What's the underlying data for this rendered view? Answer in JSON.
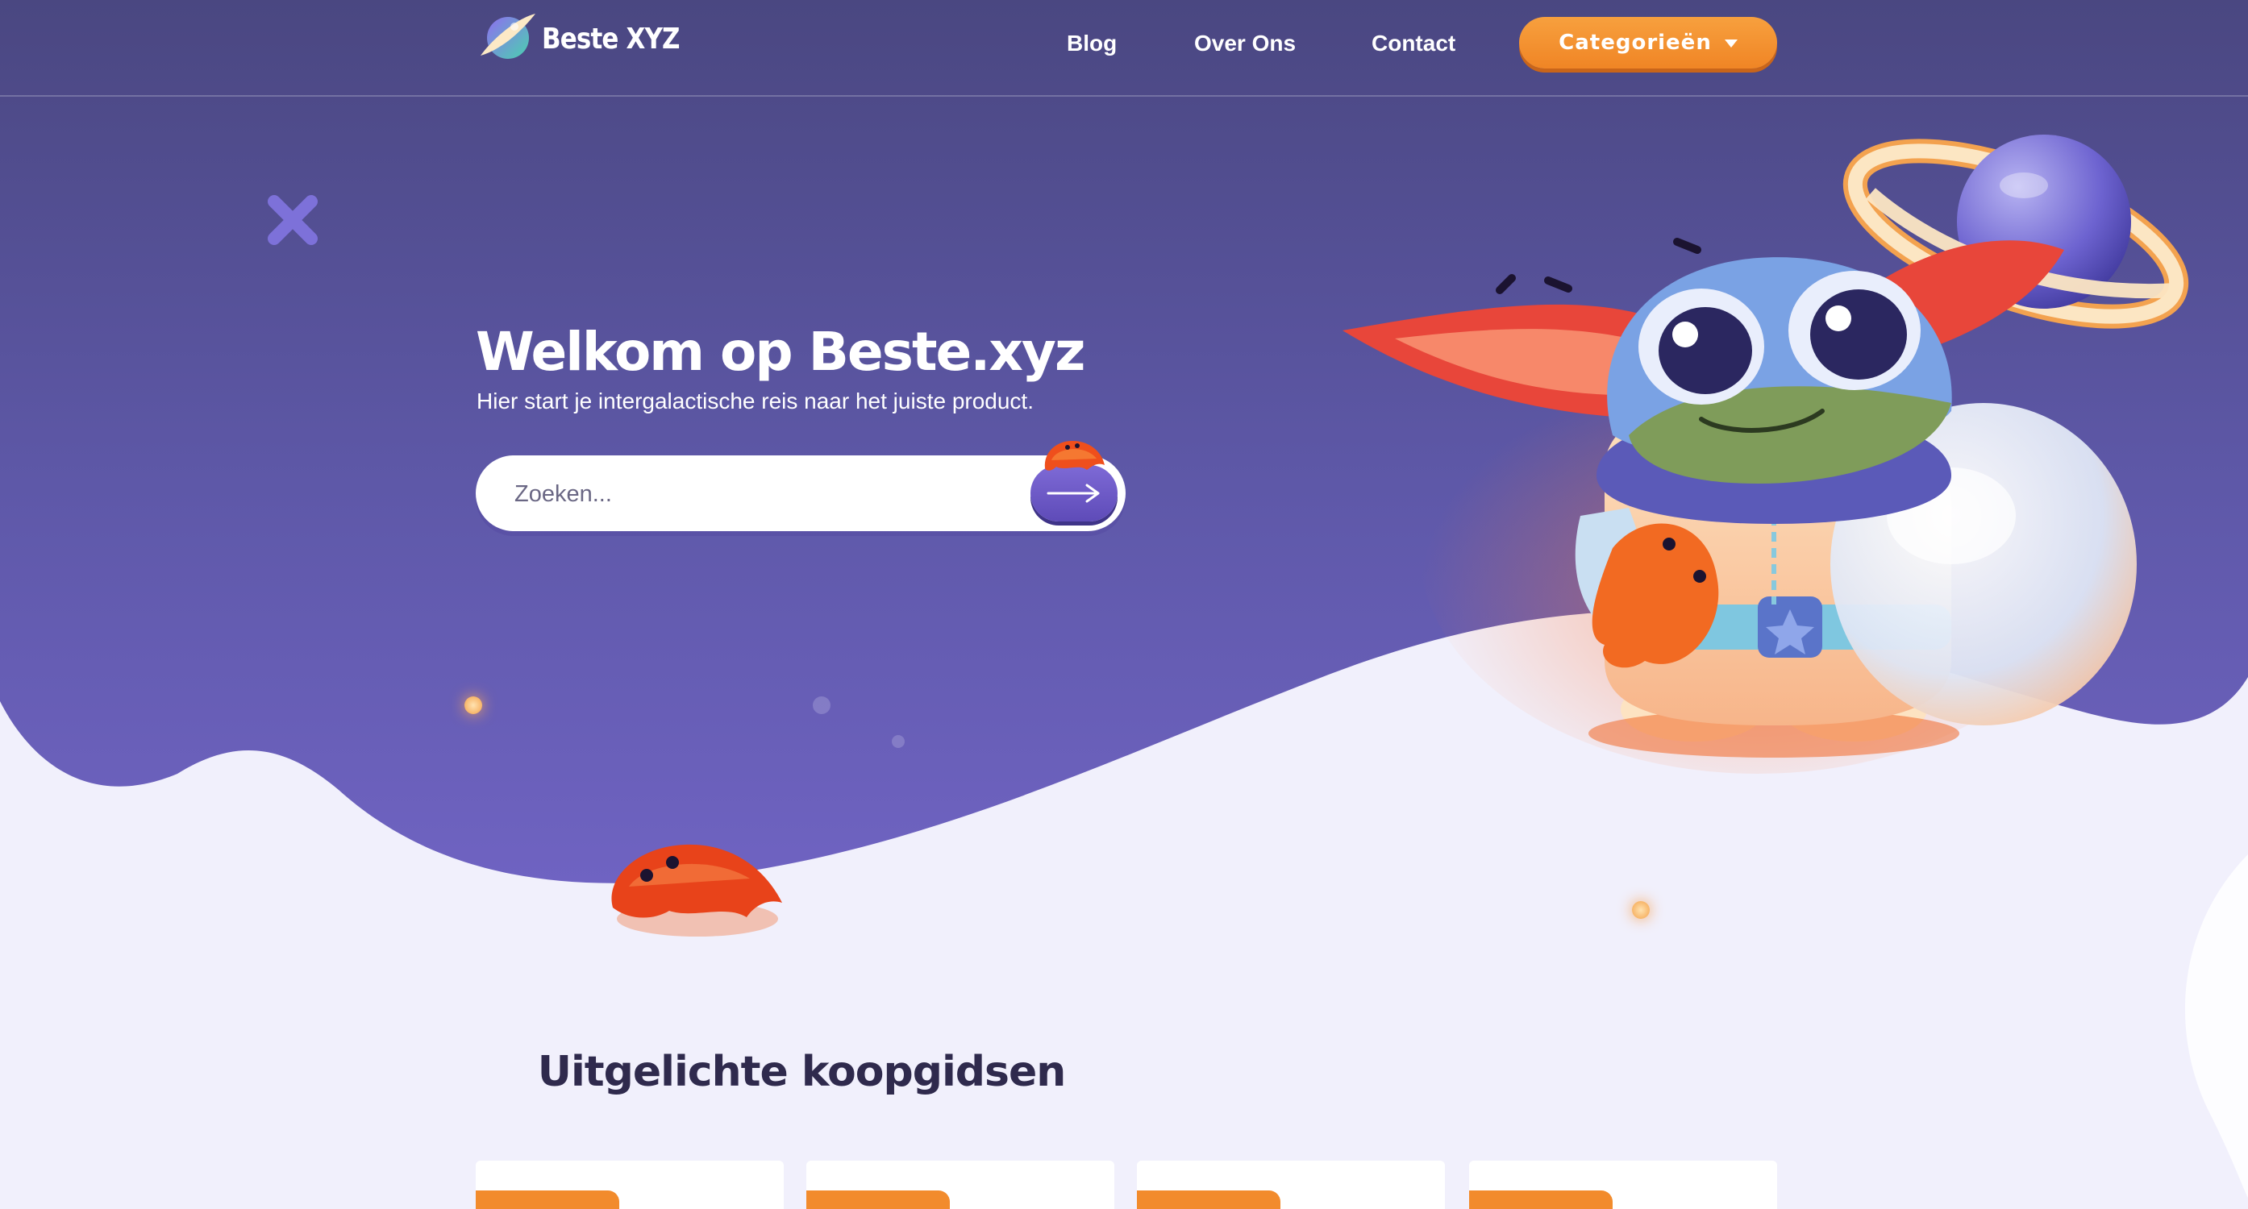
{
  "brand": {
    "name": "Beste XYZ"
  },
  "nav": {
    "links": [
      {
        "label": "Blog"
      },
      {
        "label": "Over Ons"
      },
      {
        "label": "Contact"
      }
    ],
    "categories_label": "Categorieën"
  },
  "hero": {
    "title": "Welkom op Beste.xyz",
    "subtitle": "Hier start je intergalactische reis naar het juiste product.",
    "search_placeholder": "Zoeken..."
  },
  "featured": {
    "title": "Uitgelichte koopgidsen",
    "cards": [
      {
        "badge": ""
      },
      {
        "badge": ""
      },
      {
        "badge": ""
      },
      {
        "badge": ""
      }
    ]
  },
  "icons": {
    "logo": "planet-logo-icon",
    "categories_caret": "caret-down-icon",
    "search_submit": "arrow-right-icon",
    "mascot": "space-frog-mascot",
    "planet": "ringed-planet-illustration",
    "crab": "orange-crab-illustration",
    "x_deco": "x-sparkle-icon"
  },
  "colors": {
    "hero_top": "#4a4781",
    "hero_bottom": "#6f63bf",
    "page_bg": "#f1f0fc",
    "accent_orange": "#f28b2c",
    "heading_dark": "#2f2a4d"
  }
}
